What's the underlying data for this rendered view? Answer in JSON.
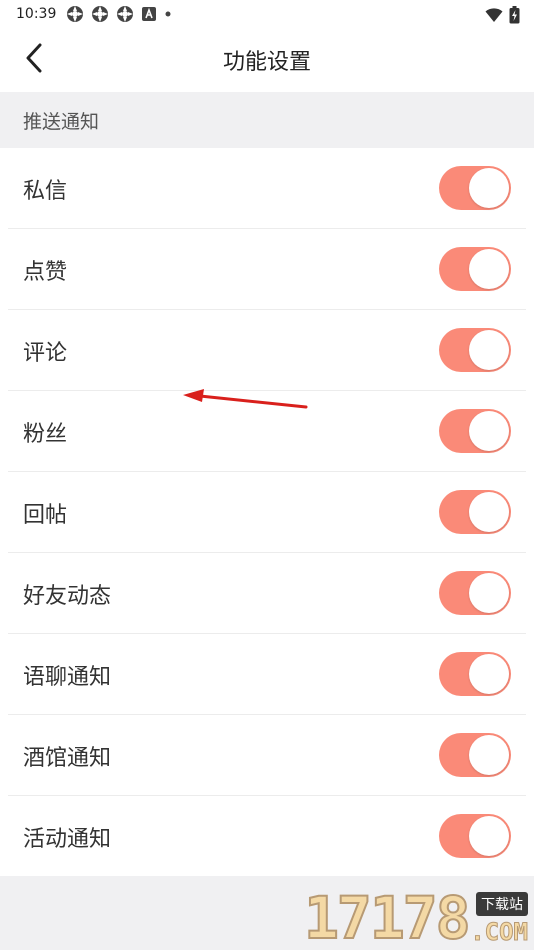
{
  "status_bar": {
    "time": "10:39",
    "icons": [
      "app-notification-icon",
      "app-notification-icon",
      "app-notification-icon",
      "a-notification-icon",
      "dot-icon",
      "wifi-icon",
      "battery-charging-icon"
    ]
  },
  "header": {
    "title": "功能设置",
    "back_icon": "chevron-left-icon"
  },
  "section": {
    "title": "推送通知"
  },
  "settings": [
    {
      "label": "私信",
      "enabled": true
    },
    {
      "label": "点赞",
      "enabled": true
    },
    {
      "label": "评论",
      "enabled": true
    },
    {
      "label": "粉丝",
      "enabled": true
    },
    {
      "label": "回帖",
      "enabled": true
    },
    {
      "label": "好友动态",
      "enabled": true
    },
    {
      "label": "语聊通知",
      "enabled": true
    },
    {
      "label": "酒馆通知",
      "enabled": true
    },
    {
      "label": "活动通知",
      "enabled": true
    }
  ],
  "watermark": {
    "number": "17178",
    "tag": "下载站",
    "suffix": ".COM"
  },
  "colors": {
    "toggle_on": "#fa8a78",
    "section_bg": "#f0f0f2",
    "arrow": "#d9201c"
  }
}
